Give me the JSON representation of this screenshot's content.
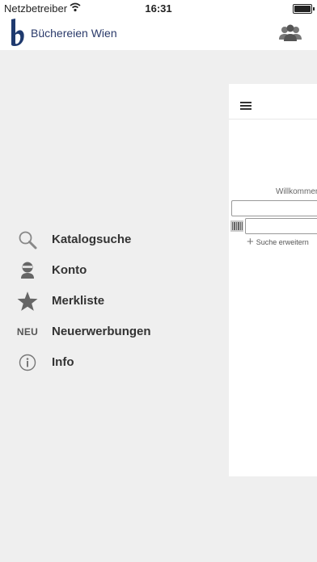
{
  "statusbar": {
    "carrier": "Netzbetreiber",
    "time": "16:31"
  },
  "appbar": {
    "title": "Büchereien Wien",
    "logo_icon": "b-logo-icon",
    "users_icon": "users-icon"
  },
  "menu": {
    "items": [
      {
        "label": "Katalogsuche",
        "icon": "search-icon"
      },
      {
        "label": "Konto",
        "icon": "user-icon"
      },
      {
        "label": "Merkliste",
        "icon": "star-icon"
      },
      {
        "label": "Neuerwerbungen",
        "icon": "new-badge-icon",
        "icon_text": "NEU"
      },
      {
        "label": "Info",
        "icon": "info-icon"
      }
    ]
  },
  "panel": {
    "welcome": "Willkommen",
    "expand_search": "Suche erweitern"
  },
  "colors": {
    "brand": "#1f3a6e",
    "background": "#efefef"
  }
}
